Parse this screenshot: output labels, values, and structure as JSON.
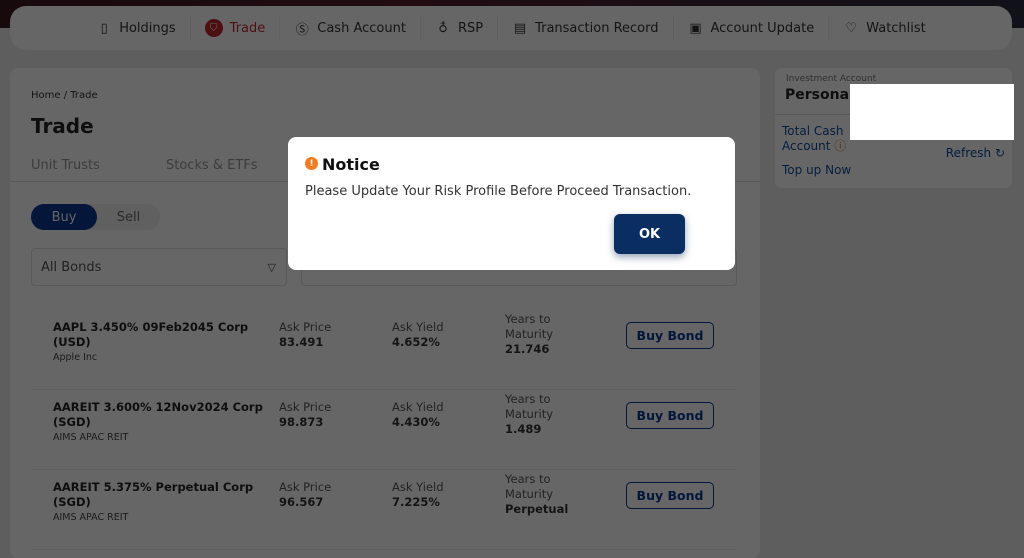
{
  "nav": [
    {
      "label": "Holdings",
      "icon": "wallet-icon"
    },
    {
      "label": "Trade",
      "icon": "cart-icon",
      "active": true
    },
    {
      "label": "Cash Account",
      "icon": "dollar-icon"
    },
    {
      "label": "RSP",
      "icon": "bulb-icon"
    },
    {
      "label": "Transaction Record",
      "icon": "document-icon"
    },
    {
      "label": "Account Update",
      "icon": "user-folder-icon"
    },
    {
      "label": "Watchlist",
      "icon": "heart-icon"
    }
  ],
  "breadcrumb": "Home / Trade",
  "title": "Trade",
  "tabs": [
    "Unit Trusts",
    "Stocks & ETFs"
  ],
  "toggle": {
    "buy": "Buy",
    "sell": "Sell"
  },
  "filter": {
    "value": "All Bonds"
  },
  "bonds": [
    {
      "name": "AAPL 3.450% 09Feb2045 Corp (USD)",
      "issuer": "Apple Inc",
      "ask_price_label": "Ask Price",
      "ask_price": "83.491",
      "ask_yield_label": "Ask Yield",
      "ask_yield": "4.652%",
      "maturity_label": "Years to Maturity",
      "maturity": "21.746",
      "button": "Buy Bond"
    },
    {
      "name": "AAREIT 3.600% 12Nov2024 Corp (SGD)",
      "issuer": "AIMS APAC REIT",
      "ask_price_label": "Ask Price",
      "ask_price": "98.873",
      "ask_yield_label": "Ask Yield",
      "ask_yield": "4.430%",
      "maturity_label": "Years to Maturity",
      "maturity": "1.489",
      "button": "Buy Bond"
    },
    {
      "name": "AAREIT 5.375% Perpetual Corp (SGD)",
      "issuer": "AIMS APAC REIT",
      "ask_price_label": "Ask Price",
      "ask_price": "96.567",
      "ask_yield_label": "Ask Yield",
      "ask_yield": "7.225%",
      "maturity_label": "Years to Maturity",
      "maturity": "Perpetual",
      "button": "Buy Bond"
    }
  ],
  "side": {
    "label": "Investment Account",
    "account": "Personal -",
    "total_cash": "Total Cash Account",
    "refresh": "Refresh",
    "top_up": "Top up Now"
  },
  "modal": {
    "title": "Notice",
    "message": "Please Update Your Risk Profile Before Proceed Transaction.",
    "ok": "OK"
  },
  "colors": {
    "accent": "#0a2e62",
    "trade_red": "#c0282d",
    "notice_orange": "#f47a20"
  }
}
